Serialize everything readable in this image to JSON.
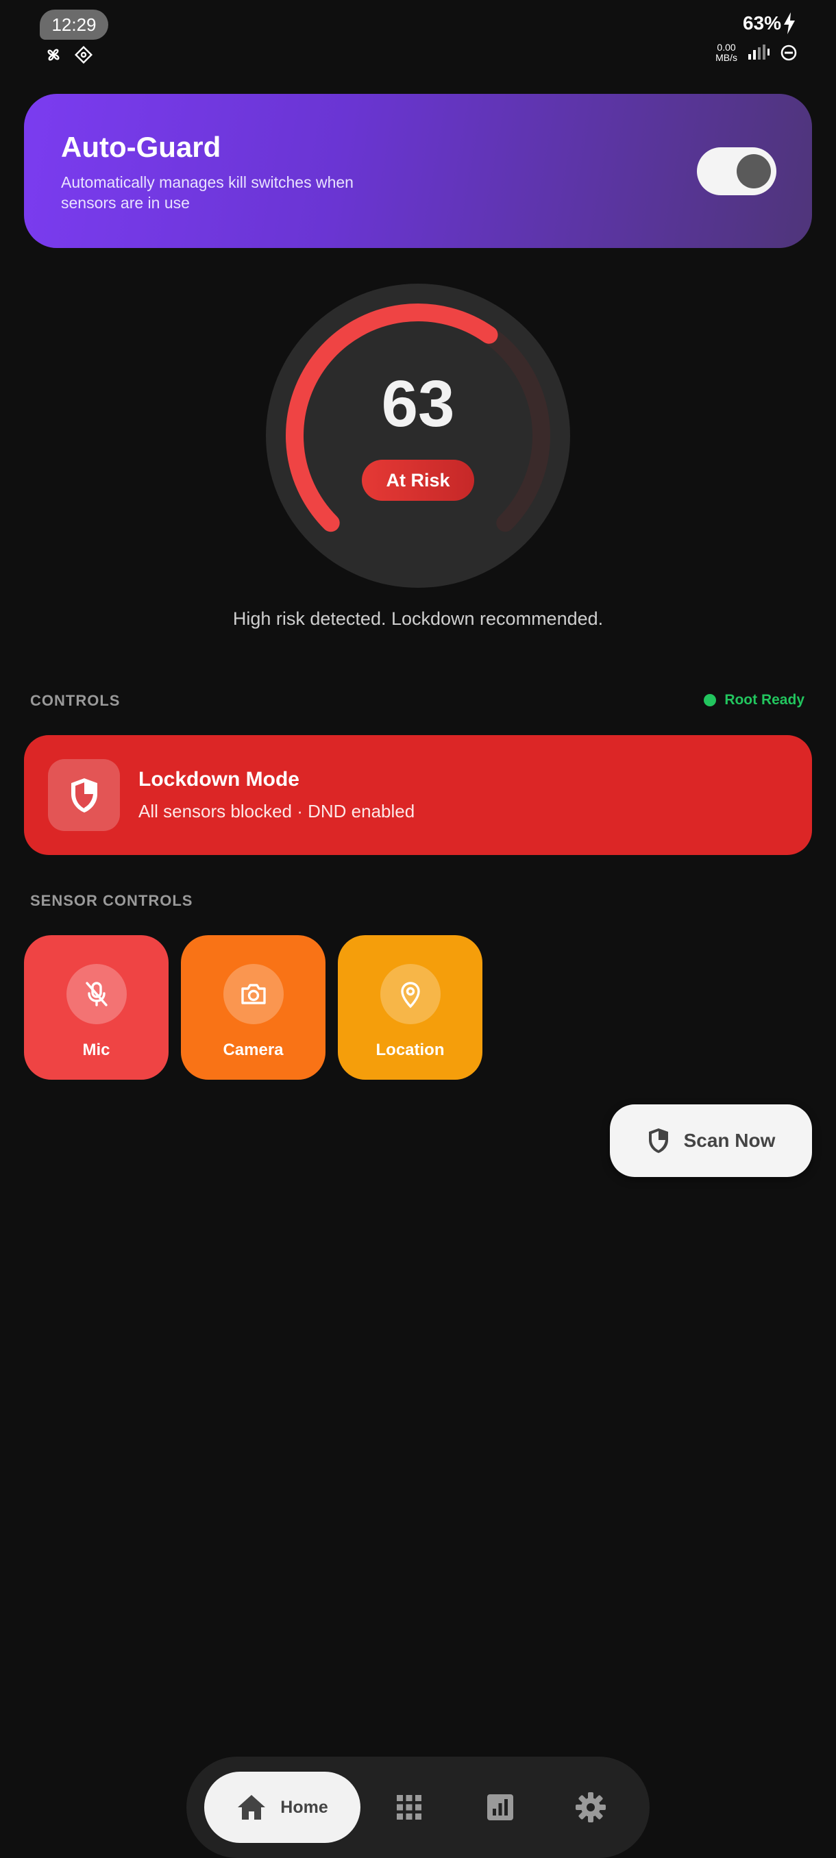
{
  "status_bar": {
    "time": "12:29",
    "battery": "63%",
    "net_speed_value": "0.00",
    "net_speed_unit": "MB/s"
  },
  "auto_guard": {
    "title": "Auto-Guard",
    "description": "Automatically manages kill switches when sensors are in use",
    "enabled": true
  },
  "risk": {
    "score": "63",
    "score_fraction": 0.63,
    "status": "At Risk",
    "message": "High risk detected. Lockdown recommended."
  },
  "controls": {
    "section_label": "CONTROLS",
    "root_status": "Root Ready",
    "lockdown": {
      "title": "Lockdown Mode",
      "subtitle": "All sensors blocked · DND enabled"
    }
  },
  "sensor_controls": {
    "section_label": "SENSOR CONTROLS",
    "tiles": [
      {
        "label": "Mic",
        "icon": "mic-off-icon",
        "color": "#ef4444"
      },
      {
        "label": "Camera",
        "icon": "camera-icon",
        "color": "#f97316"
      },
      {
        "label": "Location",
        "icon": "location-pin-icon",
        "color": "#f59e0b"
      }
    ]
  },
  "scan_button": {
    "label": "Scan Now"
  },
  "bottom_nav": {
    "items": [
      {
        "label": "Home",
        "icon": "home-icon",
        "active": true
      },
      {
        "label": "",
        "icon": "grid-icon",
        "active": false
      },
      {
        "label": "",
        "icon": "chart-icon",
        "active": false
      },
      {
        "label": "",
        "icon": "gear-icon",
        "active": false
      }
    ]
  },
  "colors": {
    "background": "#0f0f0f",
    "danger": "#dc2626",
    "success": "#22c55e",
    "accent_purple": "#7b3cf0"
  }
}
